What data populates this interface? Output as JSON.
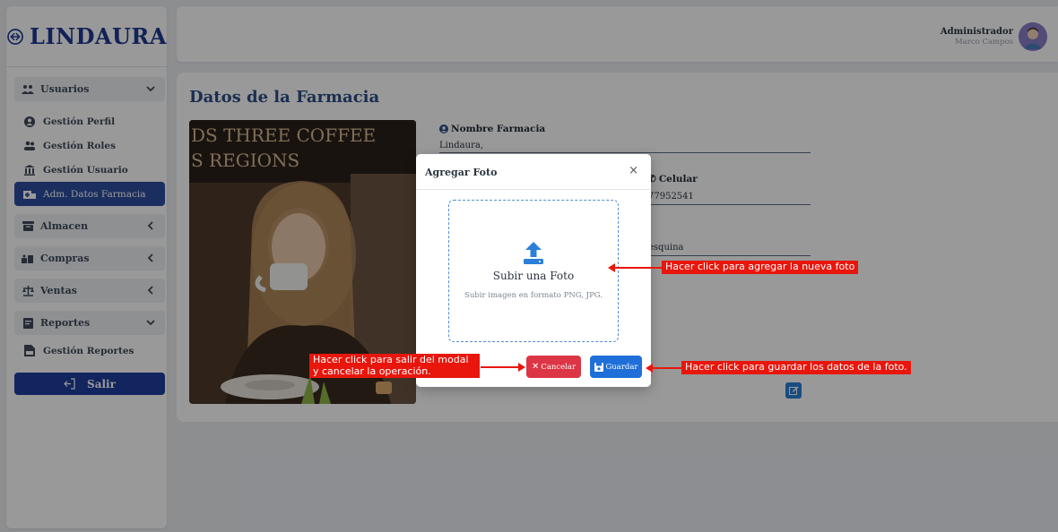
{
  "brand": {
    "name": "LINDAURA"
  },
  "sidebar": {
    "groups": [
      {
        "label": "Usuarios",
        "icon": "users-icon"
      },
      {
        "label": "Almacen",
        "icon": "warehouse-icon"
      },
      {
        "label": "Compras",
        "icon": "cart-icon"
      },
      {
        "label": "Ventas",
        "icon": "scale-icon"
      },
      {
        "label": "Reportes",
        "icon": "report-icon"
      }
    ],
    "usuarios_items": [
      {
        "label": "Gestión Perfil",
        "icon": "profile-icon"
      },
      {
        "label": "Gestión Roles",
        "icon": "roles-icon"
      },
      {
        "label": "Gestión Usuario",
        "icon": "building-icon"
      },
      {
        "label": "Adm. Datos Farmacia",
        "icon": "pharmacy-icon",
        "active": true
      }
    ],
    "reportes_items": [
      {
        "label": "Gestión Reportes",
        "icon": "pdf-report-icon"
      }
    ],
    "logout_label": "Salir"
  },
  "header": {
    "user_role": "Administrador",
    "user_name": "Marco Campos"
  },
  "main": {
    "title": "Datos de la Farmacia",
    "photo_text_line1": "DS THREE COFFEE",
    "photo_text_line2": "S  REGIONS",
    "fields": {
      "nombre_label": "Nombre Farmacia",
      "nombre_value": "Lindaura,",
      "celular_label": "Celular",
      "celular_value": "77952541",
      "direccion_value": "esquina"
    }
  },
  "modal": {
    "title": "Agregar Foto",
    "close": "×",
    "dropzone_title": "Subir una Foto",
    "dropzone_subtitle": "Subir imagen en formato PNG, JPG.",
    "cancel_label": "Cancelar",
    "save_label": "Guardar"
  },
  "annotations": {
    "upload": "Hacer click para agregar la nueva foto",
    "cancel_line1": "Hacer click para salir del modal",
    "cancel_line2": "y cancelar la operación.",
    "save": "Hacer click para guardar los datos de la foto."
  },
  "colors": {
    "brand": "#1f3a93",
    "active_nav": "#2d4da0",
    "cancel": "#dc3545",
    "save": "#1f6fd8",
    "annotation": "#e8160c"
  }
}
